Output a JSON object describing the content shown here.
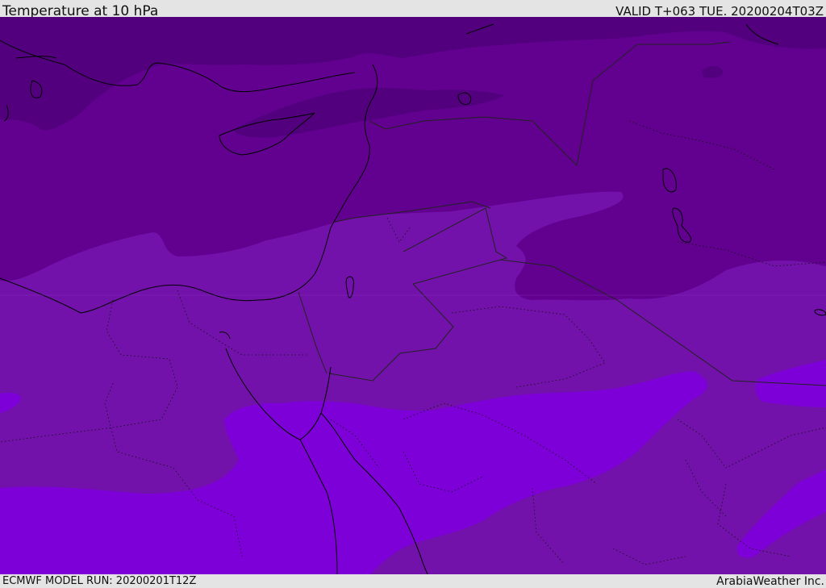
{
  "header": {
    "title": "Temperature at 10 hPa",
    "valid": "VALID T+063 TUE. 20200204T03Z"
  },
  "footer": {
    "model_run": "ECMWF MODEL RUN: 20200201T12Z",
    "credit": "ArabiaWeather Inc."
  },
  "colors": {
    "band_coldest": "#52007e",
    "band_cold": "#620090",
    "band_mid": "#7212aa",
    "band_warm": "#7e00d8",
    "coastline": "#000000",
    "border": "#222222",
    "frame": "#e4e4e4"
  }
}
